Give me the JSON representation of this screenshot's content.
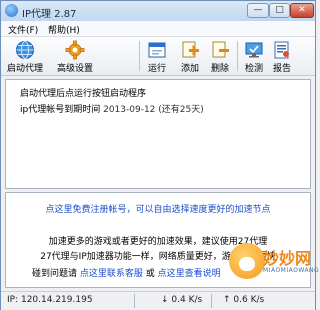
{
  "window": {
    "title": "IP代理 2.87",
    "min": "—",
    "max": "□",
    "close": "✕"
  },
  "menu": [
    {
      "label": "文件(F)"
    },
    {
      "label": "帮助(H)"
    }
  ],
  "toolbar": {
    "start": "启动代理",
    "advanced": "高级设置",
    "run": "运行",
    "add": "添加",
    "delete": "删除",
    "check": "检测",
    "report": "报告"
  },
  "status_panel": {
    "line1": "启动代理后点运行按钮启动程序",
    "line2_prefix": "ip代理帐号到期时间",
    "line2_date": "2013-09-12 (还有25天)"
  },
  "promo_panel": {
    "register_link": "点这里免费注册帐号，可以自由选择速度更好的加速节点",
    "body1": "加速更多的游戏或者更好的加速效果，建议使用27代理",
    "body2": "27代理与IP加速器功能一样，网络质量更好，游戏响应更快",
    "help_prefix": "碰到问题请",
    "help_link1": "点这里联系客服",
    "help_or": "或",
    "help_link2": "点这里查看说明"
  },
  "statusbar": {
    "ip": "IP: 120.14.219.195",
    "down": "0.4 K/s",
    "up": "0.6 K/s"
  },
  "watermark": {
    "text": "妙妙网",
    "sub": "MIAOMIAOWANG"
  }
}
